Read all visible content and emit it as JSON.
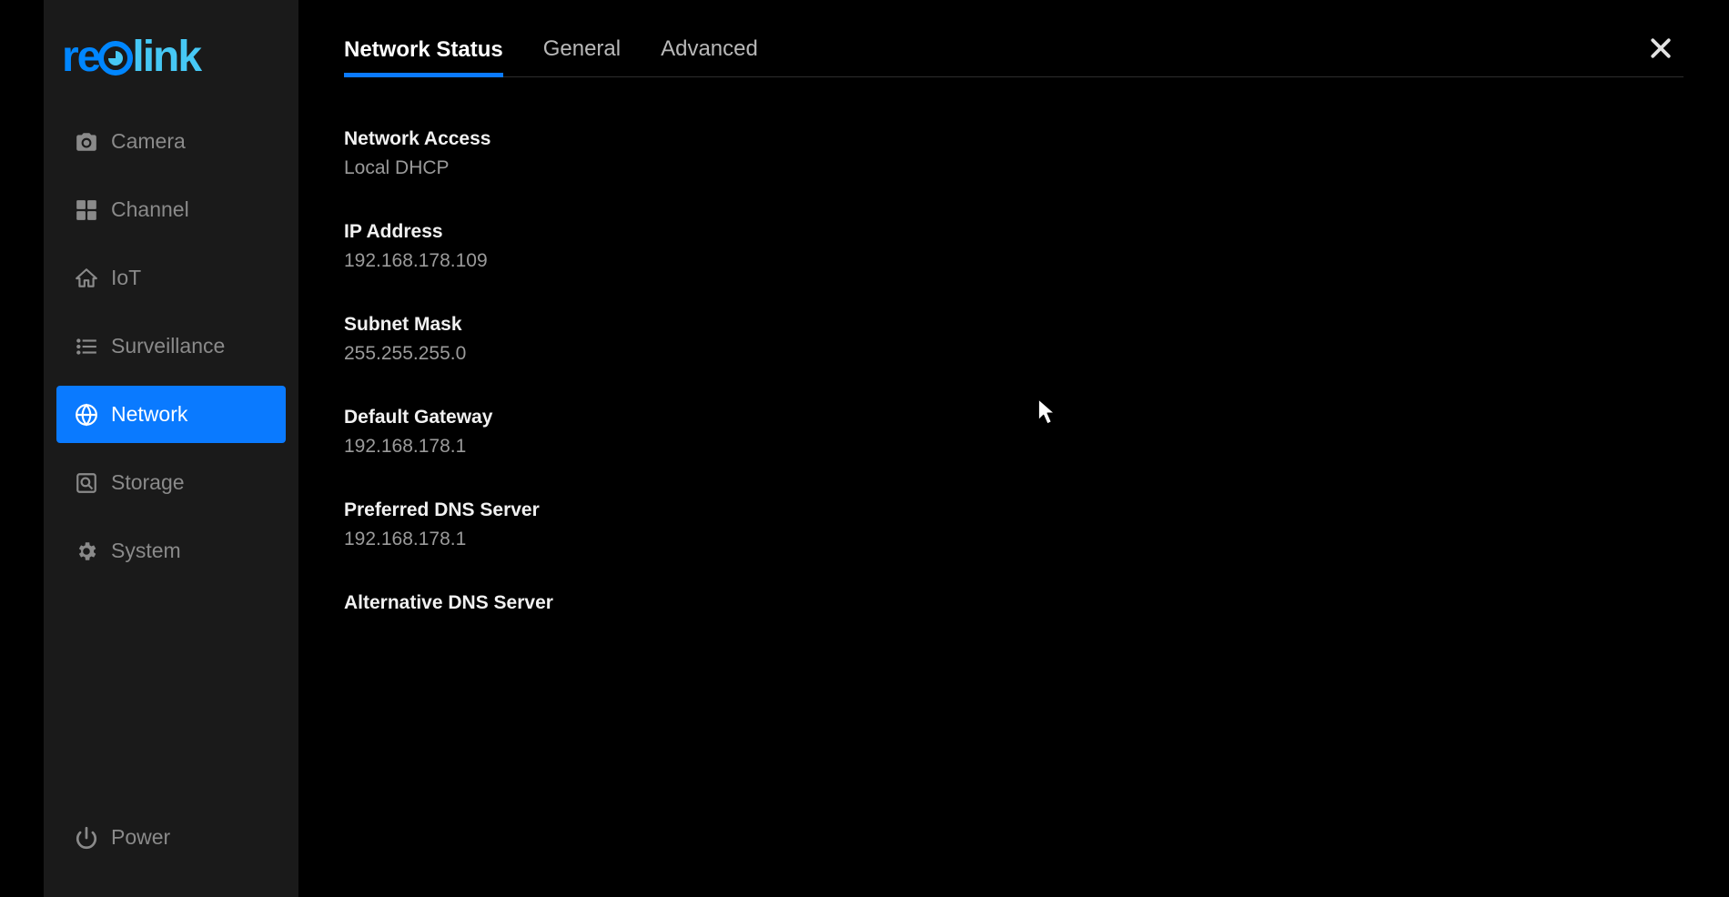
{
  "brand": {
    "prefix": "re",
    "suffix": "link"
  },
  "sidebar": {
    "items": [
      {
        "id": "camera",
        "label": "Camera",
        "icon": "camera-icon"
      },
      {
        "id": "channel",
        "label": "Channel",
        "icon": "grid-icon"
      },
      {
        "id": "iot",
        "label": "IoT",
        "icon": "home-icon"
      },
      {
        "id": "surveillance",
        "label": "Surveillance",
        "icon": "list-icon"
      },
      {
        "id": "network",
        "label": "Network",
        "icon": "globe-icon"
      },
      {
        "id": "storage",
        "label": "Storage",
        "icon": "search-doc-icon"
      },
      {
        "id": "system",
        "label": "System",
        "icon": "gear-icon"
      }
    ],
    "active_index": 4,
    "bottom": {
      "id": "power",
      "label": "Power",
      "icon": "power-icon"
    }
  },
  "tabs": {
    "items": [
      "Network Status",
      "General",
      "Advanced"
    ],
    "active_index": 0
  },
  "network_status": {
    "fields": [
      {
        "label": "Network Access",
        "value": "Local DHCP"
      },
      {
        "label": "IP Address",
        "value": "192.168.178.109"
      },
      {
        "label": "Subnet Mask",
        "value": "255.255.255.0"
      },
      {
        "label": "Default Gateway",
        "value": "192.168.178.1"
      },
      {
        "label": "Preferred DNS Server",
        "value": "192.168.178.1"
      },
      {
        "label": "Alternative DNS Server",
        "value": ""
      }
    ]
  }
}
